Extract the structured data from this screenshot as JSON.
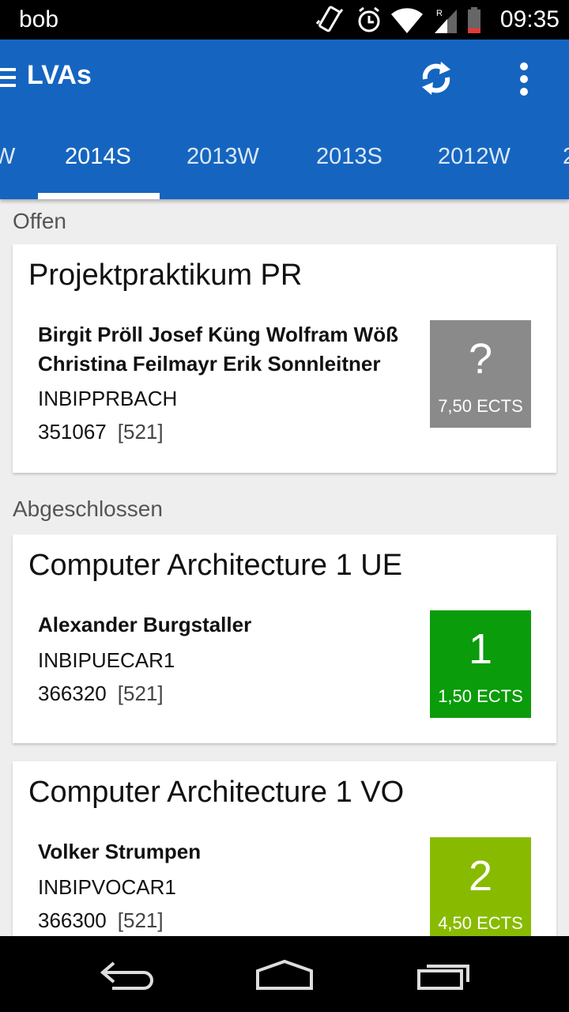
{
  "status_bar": {
    "carrier": "bob",
    "time": "09:35",
    "network_type": "R",
    "icons": [
      "vibrate-icon",
      "alarm-icon",
      "wifi-icon",
      "signal-icon",
      "battery-icon"
    ]
  },
  "toolbar": {
    "title": "LVAs",
    "icons": [
      "hamburger-menu-icon",
      "refresh-icon",
      "overflow-menu-icon"
    ]
  },
  "tabs": [
    {
      "label": "W"
    },
    {
      "label": "2014S",
      "active": true
    },
    {
      "label": "2013W"
    },
    {
      "label": "2013S"
    },
    {
      "label": "2012W"
    },
    {
      "label": "2"
    }
  ],
  "sections": {
    "open": "Offen",
    "done": "Abgeschlossen"
  },
  "courses": [
    {
      "title": "Projektpraktikum PR",
      "lecturers_line1": "Birgit Pröll Josef Küng Wolfram Wöß",
      "lecturers_line2": "Christina Feilmayr Erik Sonnleitner",
      "code": "INBIPPRBACH",
      "lva_nr": "351067",
      "studyplan": "[521]",
      "grade": "?",
      "ects": "7,50 ECTS",
      "color": "#8a8a8a"
    },
    {
      "title": "Computer Architecture 1 UE",
      "lecturers_line1": "Alexander Burgstaller",
      "code": "INBIPUECAR1",
      "lva_nr": "366320",
      "studyplan": "[521]",
      "grade": "1",
      "ects": "1,50 ECTS",
      "color": "#0a9c0a"
    },
    {
      "title": "Computer Architecture 1 VO",
      "lecturers_line1": "Volker Strumpen",
      "code": "INBIPVOCAR1",
      "lva_nr": "366300",
      "studyplan": "[521]",
      "grade": "2",
      "ects": "4,50 ECTS",
      "color": "#88bb00"
    }
  ],
  "colors": {
    "primary": "#1565c0",
    "background": "#eeeeee"
  },
  "nav_bar": {
    "icons": [
      "back-icon",
      "home-icon",
      "recents-icon"
    ]
  }
}
